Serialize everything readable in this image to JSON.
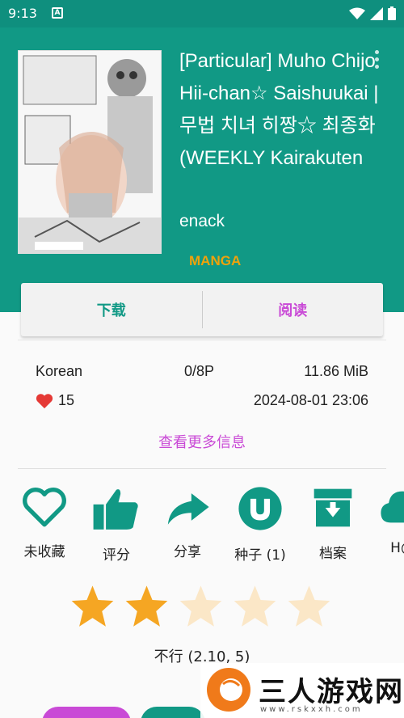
{
  "status_bar": {
    "time": "9:13",
    "notification_icon": "a-badge-icon",
    "wifi_icon": "wifi-icon",
    "signal_icon": "signal-icon",
    "battery_icon": "battery-icon"
  },
  "gallery": {
    "title": "[Particular] Muho Chijo Hii-chan☆ Saishuukai | 무법 치녀 히짱☆ 최종화 (WEEKLY Kairakuten",
    "uploader": "enack",
    "category": "MANGA",
    "cover_icon": "manga-cover-thumbnail"
  },
  "actions": {
    "download_label": "下载",
    "read_label": "阅读"
  },
  "info": {
    "language": "Korean",
    "pages": "0/8P",
    "size": "11.86 MiB",
    "favorites": "15",
    "posted": "2024-08-01 23:06",
    "more_label": "查看更多信息"
  },
  "features": [
    {
      "label": "未收藏",
      "icon": "heart-outline-icon"
    },
    {
      "label": "评分",
      "icon": "thumbs-up-icon"
    },
    {
      "label": "分享",
      "icon": "share-icon"
    },
    {
      "label": "种子 (1)",
      "icon": "torrent-icon"
    },
    {
      "label": "档案",
      "icon": "archive-icon"
    },
    {
      "label": "H@",
      "icon": "cloud-download-icon"
    }
  ],
  "rating": {
    "stars_filled": 2,
    "stars_total": 5,
    "text": "不行 (2.10, 5)"
  },
  "watermark": {
    "text": "三人游戏网",
    "url": "www.rskxxh.com"
  },
  "colors": {
    "primary": "#119985",
    "accent": "#c94ad6",
    "category": "#f0a20a",
    "star": "#f5a623"
  }
}
